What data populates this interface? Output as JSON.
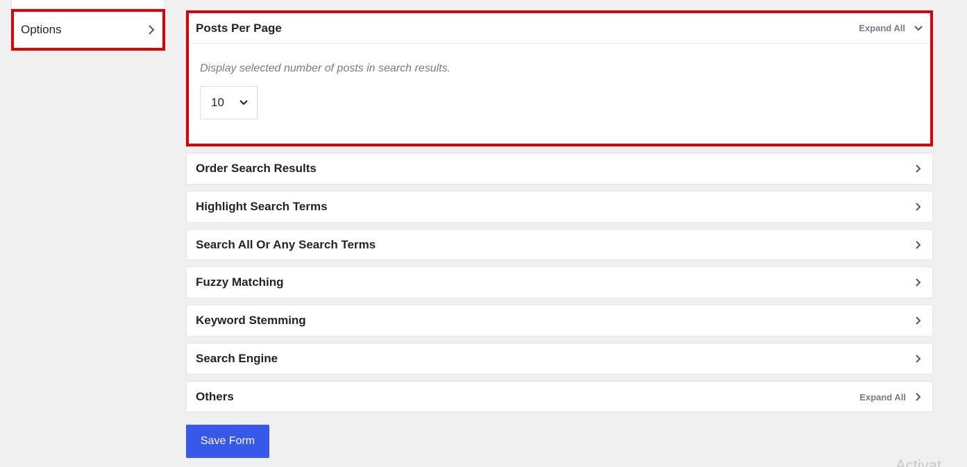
{
  "sidenav": {
    "items": [
      {
        "label": "Options",
        "icon": "chevron-right-icon"
      }
    ]
  },
  "panels": [
    {
      "title": "Posts Per Page",
      "expand_all": "Expand All",
      "expanded": true,
      "description": "Display selected number of posts in search results.",
      "select_value": "10"
    },
    {
      "title": "Order Search Results"
    },
    {
      "title": "Highlight Search Terms"
    },
    {
      "title": "Search All Or Any Search Terms"
    },
    {
      "title": "Fuzzy Matching"
    },
    {
      "title": "Keyword Stemming"
    },
    {
      "title": "Search Engine"
    },
    {
      "title": "Others",
      "expand_all": "Expand All"
    }
  ],
  "footer": {
    "save_label": "Save Form"
  },
  "watermark": "Activat",
  "colors": {
    "highlight": "#e00000",
    "primary": "#3858e9",
    "muted": "#787c82"
  }
}
